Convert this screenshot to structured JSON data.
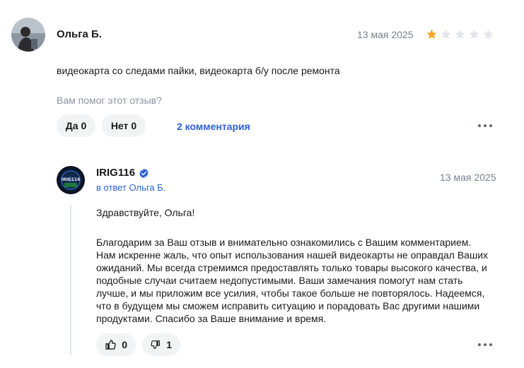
{
  "review": {
    "author": "Ольга Б.",
    "date": "13 мая 2025",
    "rating": 1,
    "max_rating": 5,
    "text": "видеокарта со следами пайки, видеокарта б/у после ремонта",
    "helpful_question": "Вам помог этот отзыв?",
    "yes_label": "Да",
    "yes_count": "0",
    "no_label": "Нет",
    "no_count": "0",
    "comments_link": "2 комментария"
  },
  "reply": {
    "author": "IRIG116",
    "avatar_text": "IRIG116",
    "in_reply_to": "в ответ Ольга Б.",
    "date": "13 мая 2025",
    "greeting": "Здравствуйте, Ольга!",
    "body": "Благодарим за Ваш отзыв и внимательно ознакомились с Вашим комментарием. Нам искренне жаль, что опыт использования нашей видеокарты не оправдал Ваших ожиданий. Мы всегда стремимся предоставлять только товары высокого качества, и подобные случаи считаем недопустимыми. Ваши замечания помогут нам стать лучше, и мы приложим все усилия, чтобы такое больше не повторялось. Надеемся, что в будущем мы сможем исправить ситуацию и порадовать Вас другими нашими продуктами. Спасибо за Ваше внимание и время.",
    "likes": "0",
    "dislikes": "1"
  },
  "colors": {
    "star_filled": "#f6a623",
    "star_empty": "#e2e5e9",
    "accent": "#2a63d8"
  }
}
